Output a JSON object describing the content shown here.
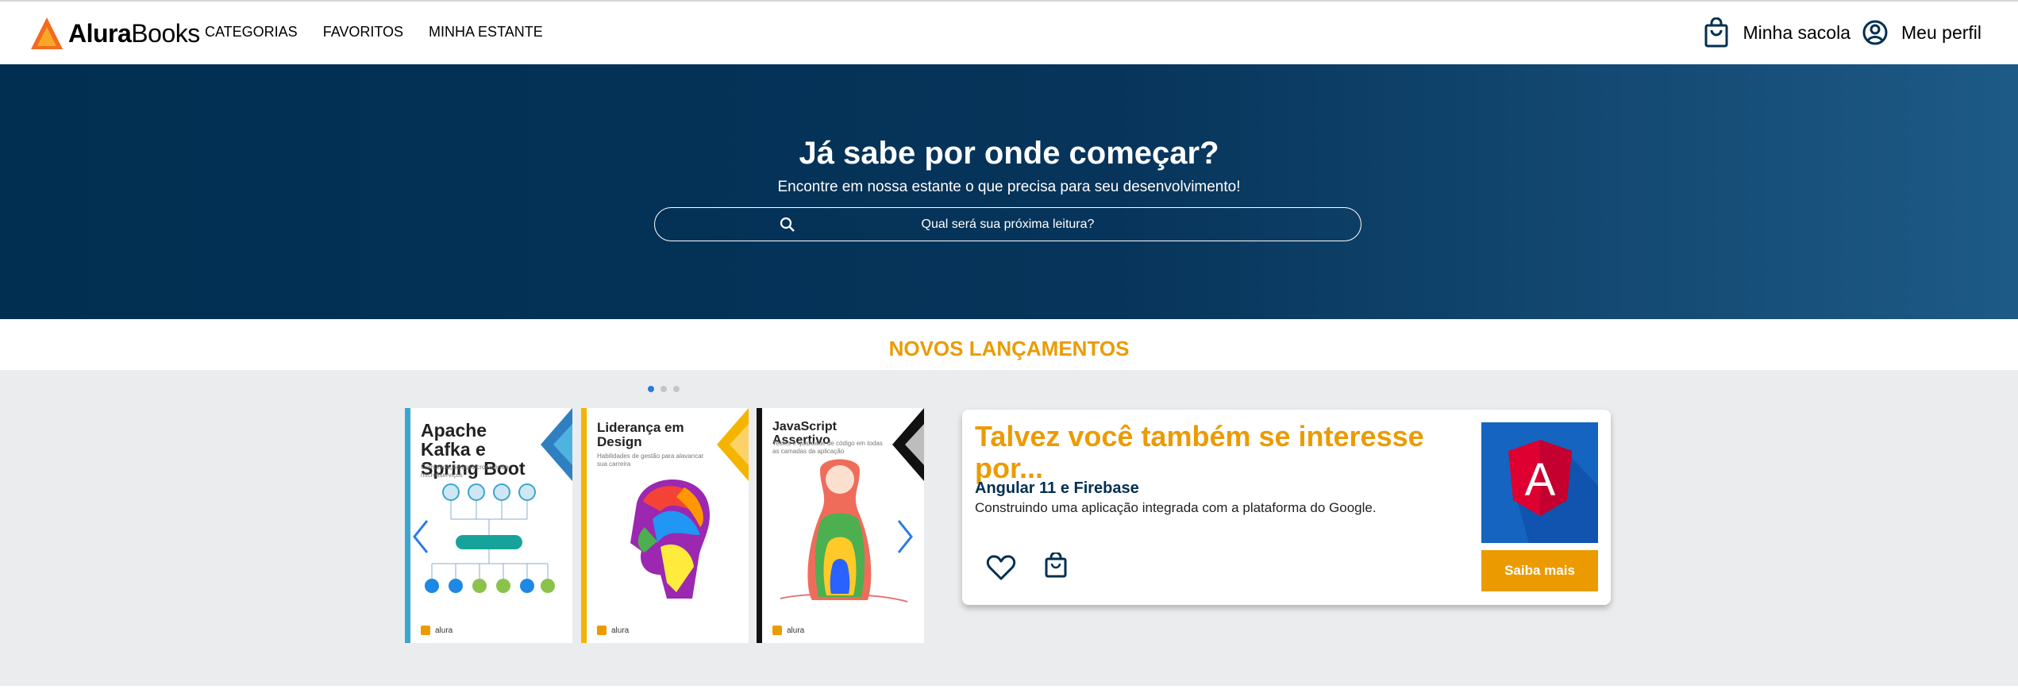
{
  "header": {
    "logo_part1": "Alura",
    "logo_part2": "Books",
    "nav": [
      "CATEGORIAS",
      "FAVORITOS",
      "MINHA ESTANTE"
    ],
    "bag_label": "Minha sacola",
    "profile_label": "Meu perfil"
  },
  "hero": {
    "title": "Já sabe por onde começar?",
    "subtitle": "Encontre em nossa estante o que precisa para seu desenvolvimento!",
    "search_placeholder": "Qual será sua próxima leitura?"
  },
  "section": {
    "title": "NOVOS LANÇAMENTOS"
  },
  "carousel": {
    "dots": 3,
    "active_dot": 0,
    "books": [
      {
        "title": "Apache Kafka e Spring Boot",
        "subtitle": "Comunicação assíncrona entre microsserviços",
        "accent": "#3aa6d0",
        "footer": "alura"
      },
      {
        "title": "Liderança em Design",
        "subtitle": "Habilidades de gestão para alavancar sua carreira",
        "accent": "#f4b400",
        "footer": "alura"
      },
      {
        "title": "JavaScript Assertivo",
        "subtitle": "Testes e qualidade de código em todas as camadas da aplicação",
        "accent": "#111111",
        "footer": "alura"
      }
    ]
  },
  "card": {
    "heading": "Talvez você também se interesse por...",
    "book_title": "Angular 11 e Firebase",
    "book_desc": "Construindo uma aplicação integrada com a plataforma do Google.",
    "button_label": "Saiba mais",
    "cover_letter": "A"
  },
  "colors": {
    "brand_dark": "#002f52",
    "accent_orange": "#eb9b00",
    "band_bg": "#ebecee"
  }
}
